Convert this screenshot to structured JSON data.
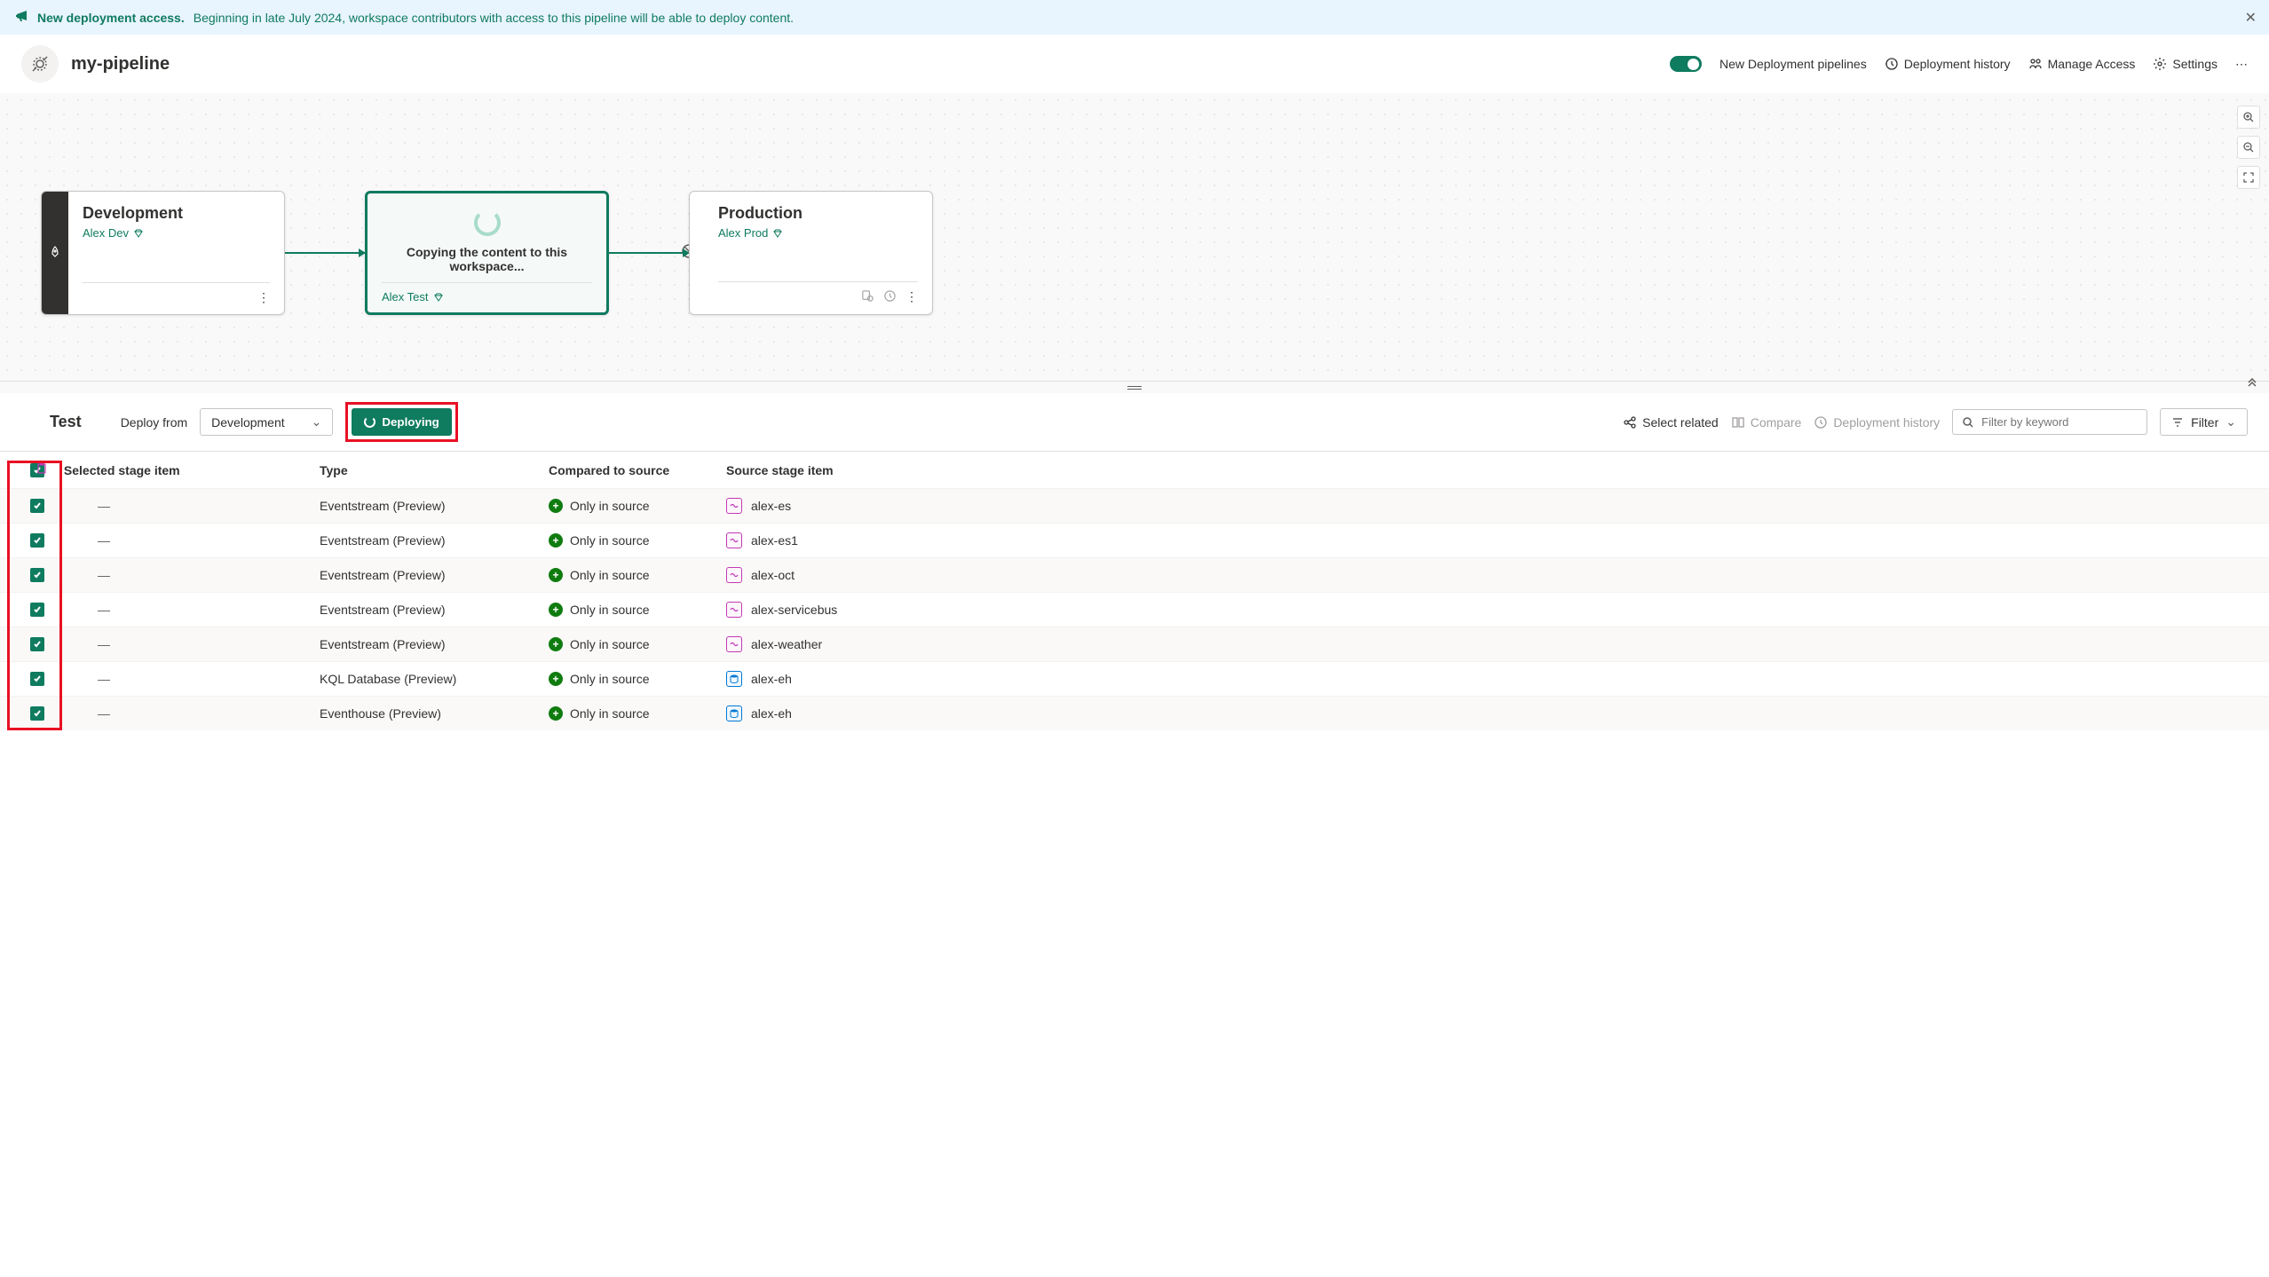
{
  "notification": {
    "title": "New deployment access.",
    "desc": "Beginning in late July 2024, workspace contributors with access to this pipeline will be able to deploy content."
  },
  "header": {
    "pipeline_name": "my-pipeline",
    "toggle_label": "New Deployment pipelines",
    "history_label": "Deployment history",
    "access_label": "Manage Access",
    "settings_label": "Settings"
  },
  "stages": {
    "dev": {
      "name": "Development",
      "workspace": "Alex Dev"
    },
    "test": {
      "name": "Test",
      "workspace": "Alex Test",
      "loading": "Copying the content to this workspace..."
    },
    "prod": {
      "name": "Production",
      "workspace": "Alex Prod"
    }
  },
  "toolbar": {
    "stage_label": "Test",
    "deploy_from": "Deploy from",
    "source_stage": "Development",
    "deploy_button": "Deploying",
    "select_related": "Select related",
    "compare": "Compare",
    "history": "Deployment history",
    "filter_placeholder": "Filter by keyword",
    "filter": "Filter"
  },
  "table": {
    "headers": {
      "selected": "Selected stage item",
      "type": "Type",
      "compared": "Compared to source",
      "source": "Source stage item"
    },
    "rows": [
      {
        "selected": "—",
        "type": "Eventstream (Preview)",
        "compared": "Only in source",
        "source": "alex-es",
        "icon": "es"
      },
      {
        "selected": "—",
        "type": "Eventstream (Preview)",
        "compared": "Only in source",
        "source": "alex-es1",
        "icon": "es"
      },
      {
        "selected": "—",
        "type": "Eventstream (Preview)",
        "compared": "Only in source",
        "source": "alex-oct",
        "icon": "es"
      },
      {
        "selected": "—",
        "type": "Eventstream (Preview)",
        "compared": "Only in source",
        "source": "alex-servicebus",
        "icon": "es"
      },
      {
        "selected": "—",
        "type": "Eventstream (Preview)",
        "compared": "Only in source",
        "source": "alex-weather",
        "icon": "es"
      },
      {
        "selected": "—",
        "type": "KQL Database (Preview)",
        "compared": "Only in source",
        "source": "alex-eh",
        "icon": "db"
      },
      {
        "selected": "—",
        "type": "Eventhouse (Preview)",
        "compared": "Only in source",
        "source": "alex-eh",
        "icon": "db"
      }
    ]
  }
}
